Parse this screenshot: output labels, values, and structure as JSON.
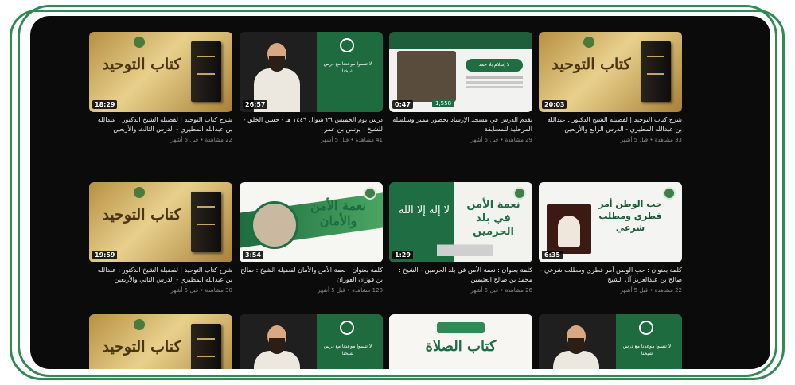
{
  "grid": {
    "rows": [
      [
        {
          "kind": "gold",
          "duration": "18:29",
          "title": "شرح كتاب التوحيد | لفضيلة الشيخ الدكتور : عبدالله بن عبدالله المطيري - الدرس الثالث والأربعين",
          "meta": "22 مشاهدة • قبل 5 أشهر",
          "thumb_text": "كتاب التوحيد"
        },
        {
          "kind": "green",
          "duration": "26:57",
          "title": "درس يوم الخميس ٢٦ شوال ١٤٤٦ هـ - حسن الخلق - للشيخ : يونس بن عمر",
          "meta": "41 مشاهدة • قبل 5 أشهر",
          "thumb_text": "لا تنسوا موعدنا مع درس شيخنا"
        },
        {
          "kind": "lesson",
          "duration": "0:47",
          "title": "تقدم الدرس في مسجد الإرشاد بحضور مميز وسلسلة المرحلية للمسابقة",
          "meta": "29 مشاهدة • قبل 5 أشهر",
          "thumb_text": "لا إسلام بلا حمد",
          "count": "1,558"
        },
        {
          "kind": "gold",
          "duration": "20:03",
          "title": "شرح كتاب التوحيد | لفضيلة الشيخ الدكتور : عبدالله بن عبدالله المطيري - الدرس الرابع والأربعين",
          "meta": "33 مشاهدة • قبل 5 أشهر",
          "thumb_text": "كتاب التوحيد"
        }
      ],
      [
        {
          "kind": "gold",
          "duration": "19:59",
          "title": "شرح كتاب التوحيد | لفضيلة الشيخ الدكتور : عبدالله بن عبدالله المطيري - الدرس الثاني والأربعين",
          "meta": "30 مشاهدة • قبل 5 أشهر",
          "thumb_text": "كتاب التوحيد"
        },
        {
          "kind": "nimah",
          "duration": "3:54",
          "title": "كلمة بعنوان : نعمة الأمن والأمان لفضيلة الشيخ : صالح بن فوزان الفوزان",
          "meta": "128 مشاهدة • قبل 5 أشهر",
          "thumb_text": "نعمة الأمن والأمان"
        },
        {
          "kind": "haram",
          "duration": "1:29",
          "title": "كلمة بعنوان : نعمة الأمن في بلد الحرمين - الشيخ : محمد بن صالح العثيمين",
          "meta": "26 مشاهدة • قبل 5 أشهر",
          "thumb_text": "نعمة الأمن في بلد الحرمين",
          "calli": "لا إله إلا الله"
        },
        {
          "kind": "watan",
          "duration": "6:35",
          "title": "كلمة بعنوان : حب الوطن أمر فطري ومطلب شرعي - صالح بن عبدالعزيز آل الشيخ",
          "meta": "22 مشاهدة • قبل 5 أشهر",
          "thumb_text": "حب الوطن أمر فطري ومطلب شرعي"
        }
      ],
      [
        {
          "kind": "gold",
          "duration": "",
          "title": "",
          "meta": "",
          "thumb_text": "كتاب التوحيد"
        },
        {
          "kind": "green",
          "duration": "",
          "title": "",
          "meta": "",
          "thumb_text": "لا تنسوا موعدنا مع درس شيخنا"
        },
        {
          "kind": "salat",
          "duration": "",
          "title": "",
          "meta": "",
          "thumb_text": "كتاب الصلاة"
        },
        {
          "kind": "green",
          "duration": "",
          "title": "",
          "meta": "",
          "thumb_text": "لا تنسوا موعدنا مع درس شيخنا"
        }
      ]
    ]
  },
  "colors": {
    "frame_green": "#2f8a55",
    "panel": "#0b0b0b",
    "accent_green": "#1f6d42",
    "gold": "#e8d08c"
  }
}
